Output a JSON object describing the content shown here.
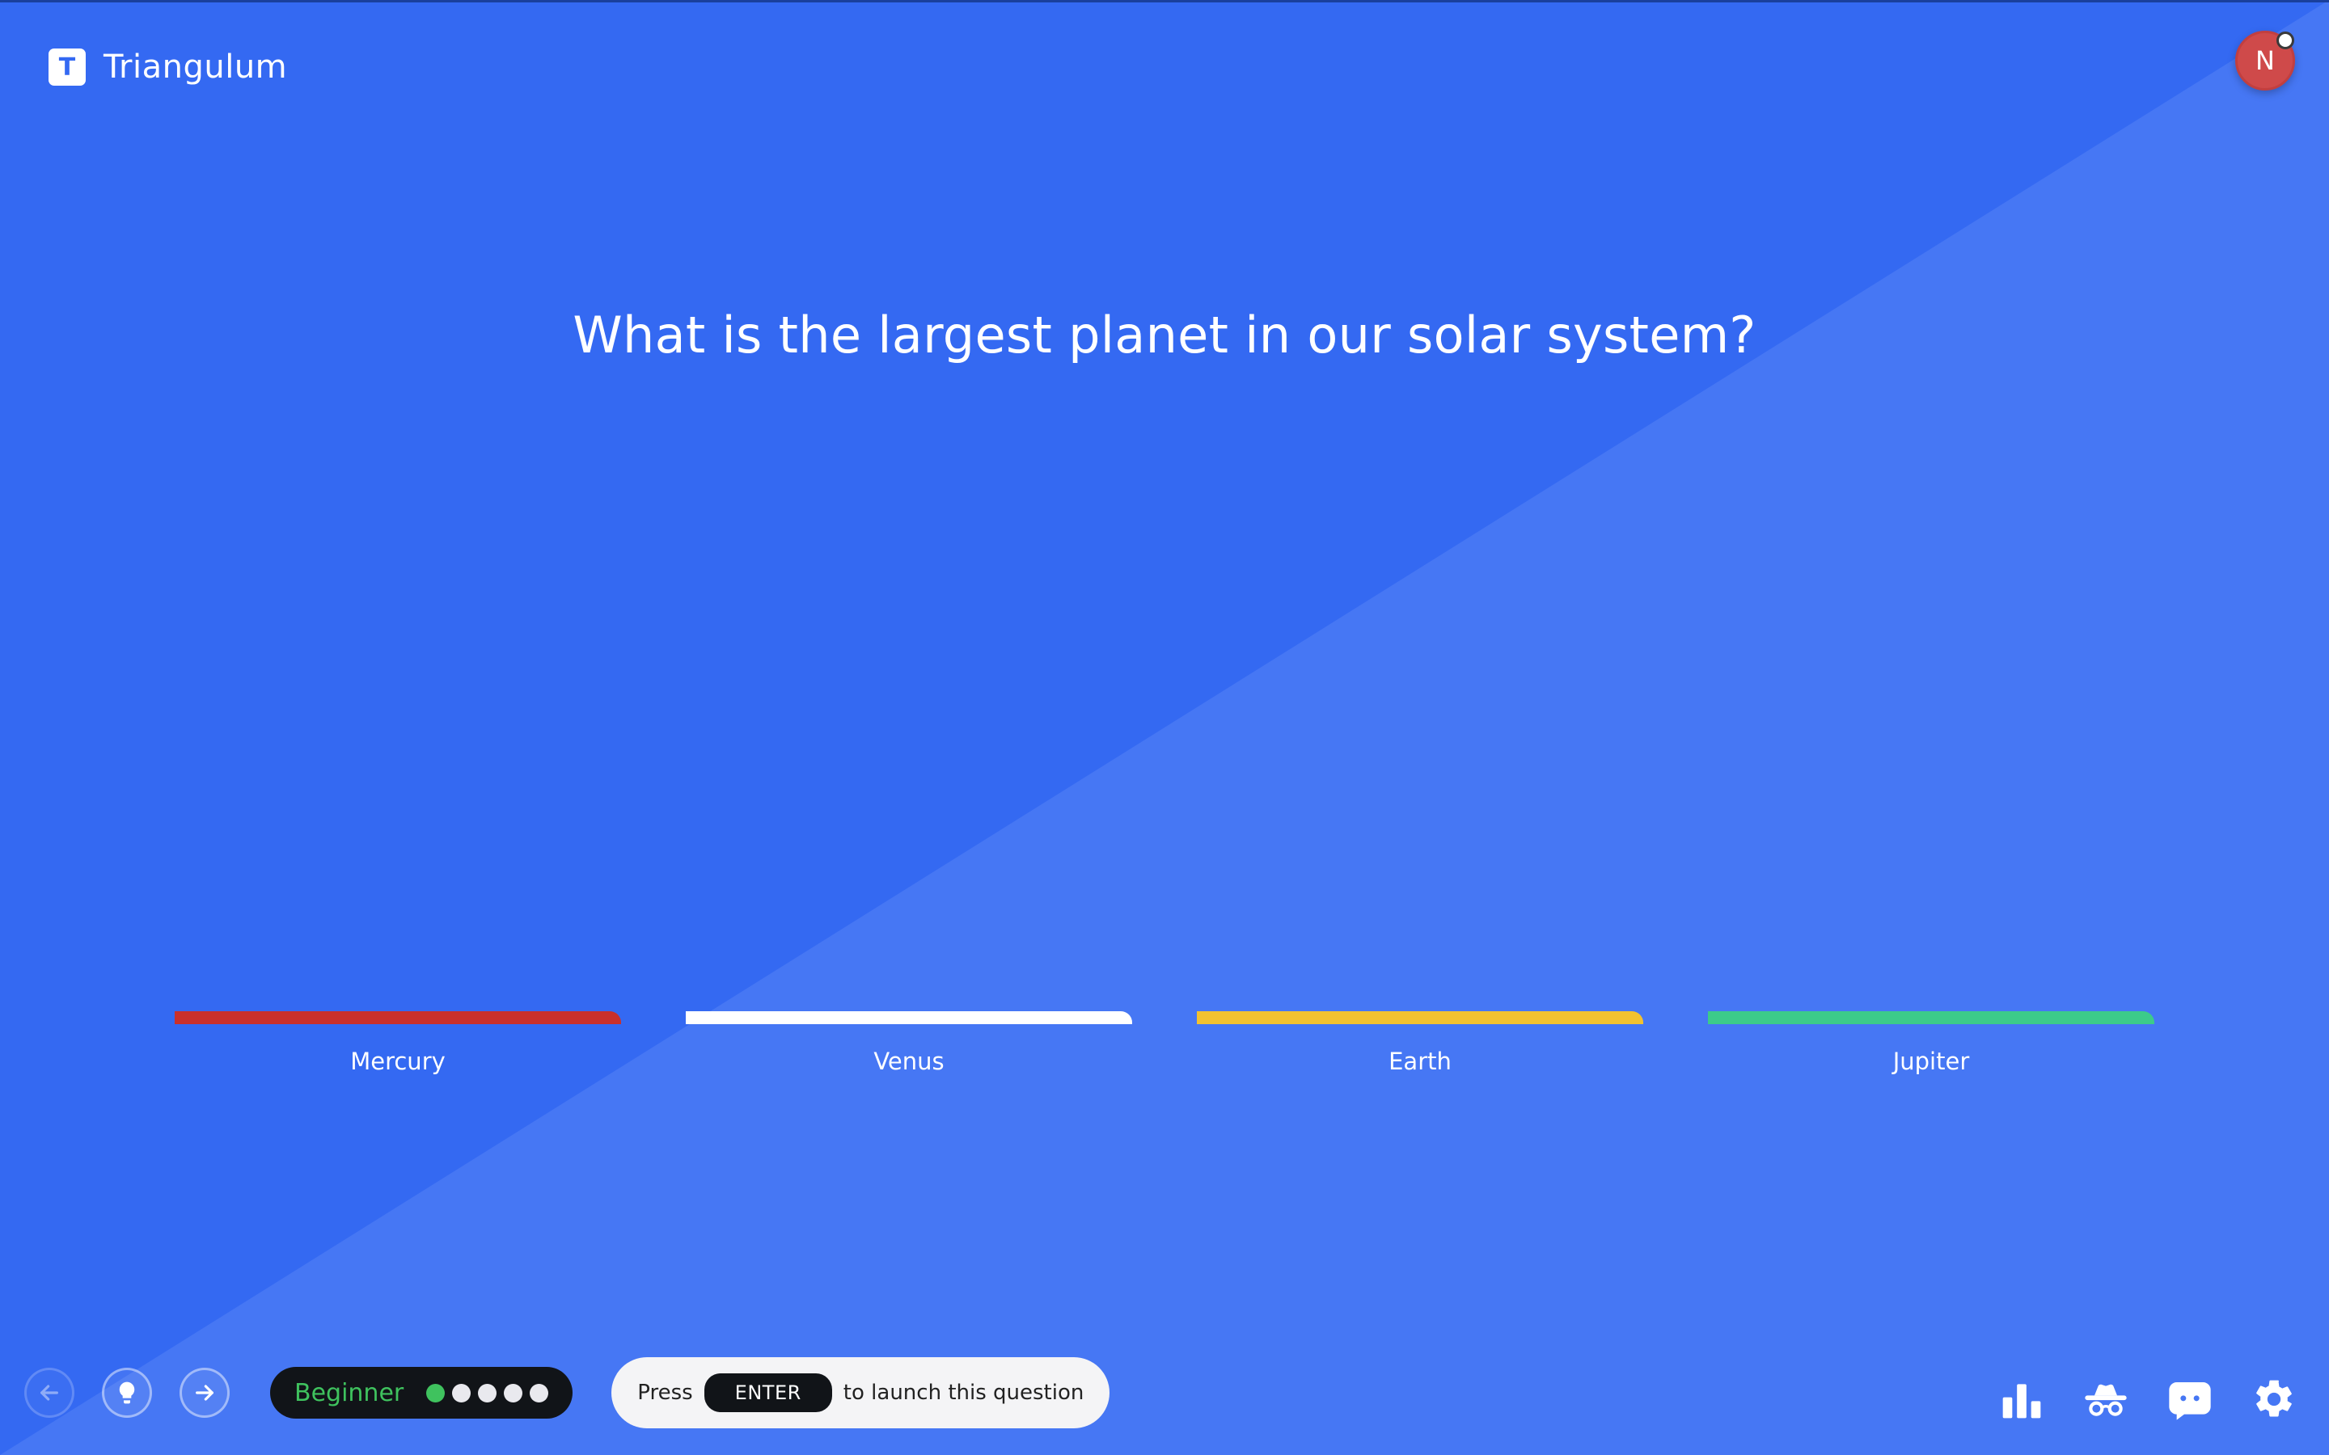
{
  "app": {
    "name": "Triangulum",
    "logo_letter": "T"
  },
  "user": {
    "avatar_initial": "N"
  },
  "question": {
    "text": "What is the largest planet in our solar system?"
  },
  "answers": [
    {
      "label": "Mercury",
      "color": "#c9302c"
    },
    {
      "label": "Venus",
      "color": "#ffffff"
    },
    {
      "label": "Earth",
      "color": "#f2c230"
    },
    {
      "label": "Jupiter",
      "color": "#3ccb8a"
    }
  ],
  "footer": {
    "nav": {
      "back_icon": "arrow-left-icon",
      "hint_icon": "lightbulb-icon",
      "next_icon": "arrow-right-icon"
    },
    "level": {
      "label": "Beginner",
      "filled": 1,
      "total": 5,
      "color": "#3fc25e"
    },
    "hint": {
      "prefix": "Press",
      "key": "ENTER",
      "suffix": "to launch this question"
    },
    "tools": [
      "bar-chart-icon",
      "incognito-icon",
      "chat-bot-icon",
      "gear-icon"
    ]
  },
  "colors": {
    "background": "#3469f2",
    "background_light": "#4677f4"
  }
}
